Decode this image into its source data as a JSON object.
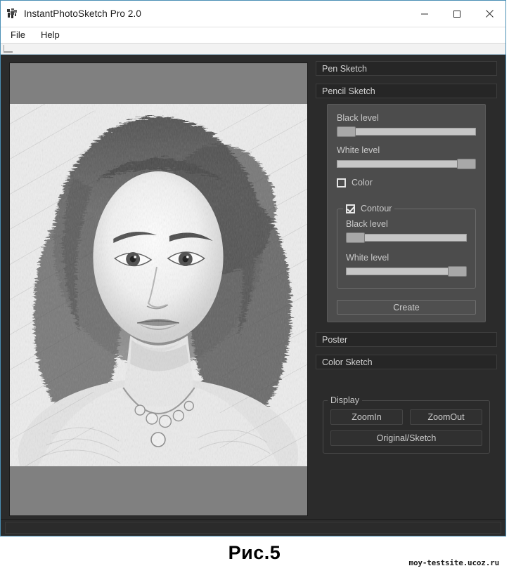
{
  "window": {
    "title": "InstantPhotoSketch Pro 2.0",
    "icon": "app-icon",
    "minimize_label": "—",
    "maximize_label": "□",
    "close_label": "✕"
  },
  "menu": {
    "items": [
      {
        "label": "File"
      },
      {
        "label": "Help"
      }
    ]
  },
  "sections": {
    "pen_sketch": "Pen Sketch",
    "pencil_sketch": "Pencil Sketch",
    "poster": "Poster",
    "color_sketch": "Color Sketch"
  },
  "pencil_panel": {
    "black_level_label": "Black level",
    "white_level_label": "White level",
    "black_level_value": 0,
    "white_level_value": 100,
    "color_checkbox": {
      "label": "Color",
      "checked": false
    },
    "contour_group": {
      "label": "Contour",
      "checked": true,
      "black_level_label": "Black level",
      "white_level_label": "White level",
      "black_level_value": 0,
      "white_level_value": 100
    },
    "create_button": "Create"
  },
  "display": {
    "group_label": "Display",
    "zoom_in": "ZoomIn",
    "zoom_out": "ZoomOut",
    "original_sketch": "Original/Sketch"
  },
  "canvas": {
    "image_description": "pencil-sketch portrait of a woman with long wavy hair",
    "letterbox_color": "#808080",
    "paper_color": "#f4f4f4"
  },
  "page": {
    "caption": "Рис.5",
    "watermark": "moy-testsite.ucoz.ru"
  },
  "colors": {
    "app_background": "#2b2b2b",
    "panel_background": "#4c4c4c",
    "section_header": "#262626",
    "title_bar": "#ffffff",
    "accent_border": "#4b8fb5"
  }
}
